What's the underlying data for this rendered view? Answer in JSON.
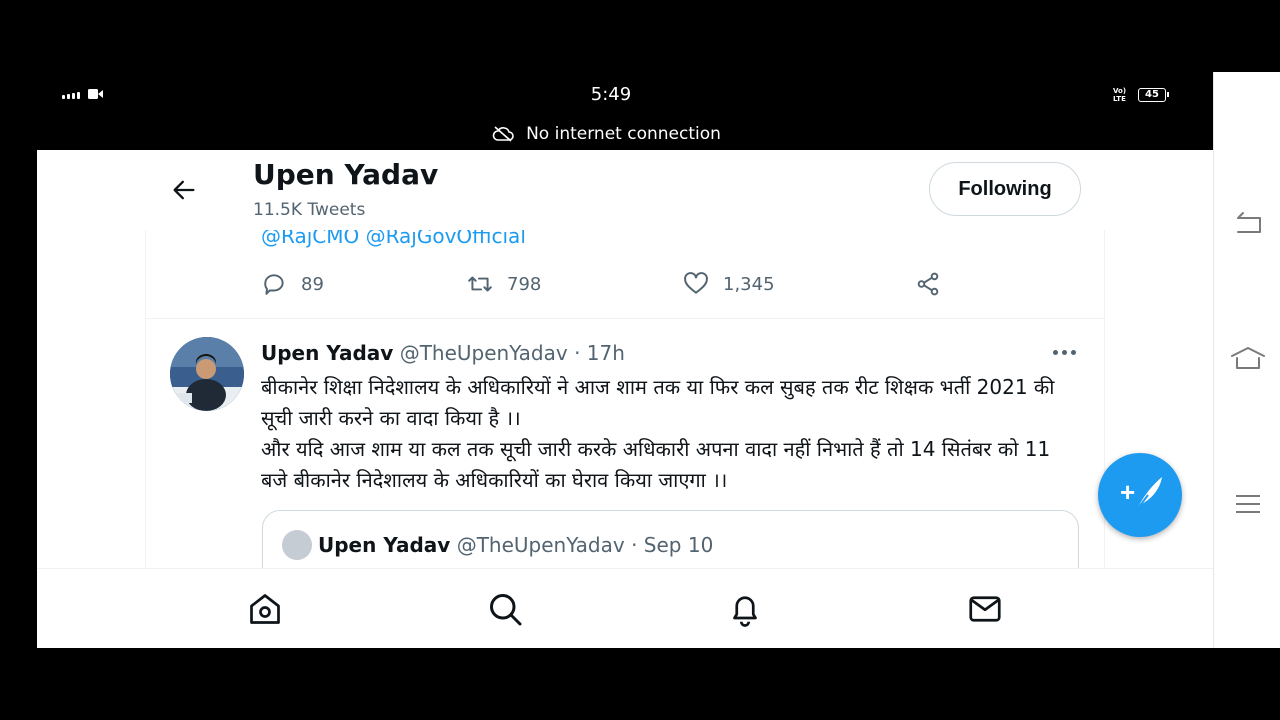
{
  "status_bar": {
    "time": "5:49",
    "network_label": "Vo) LTE",
    "battery_level": "45",
    "connection_message": "No internet connection"
  },
  "header": {
    "name": "Upen Yadav",
    "tweet_count": "11.5K Tweets",
    "follow_label": "Following"
  },
  "prev_tweet": {
    "mentions": "@RajCMO @RajGovOfficial",
    "replies": "89",
    "retweets": "798",
    "likes": "1,345"
  },
  "tweet": {
    "name": "Upen Yadav",
    "handle": "@TheUpenYadav",
    "time": " · 17h",
    "body_line1": "बीकानेर शिक्षा निदेशालय के अधिकारियों ने आज शाम तक या फिर कल सुबह तक रीट शिक्षक भर्ती 2021 की सूची जारी करने का वादा किया है ।।",
    "body_line2": "और यदि आज शाम या कल तक सूची जारी करके  अधिकारी अपना वादा नहीं निभाते हैं तो 14 सितंबर को 11 बजे बीकानेर निदेशालय के अधिकारियों का घेराव किया जाएगा ।।"
  },
  "quoted_tweet": {
    "name": "Upen Yadav",
    "handle": "@TheUpenYadav",
    "time": " · Sep 10"
  },
  "colors": {
    "accent": "#1d9bf0",
    "text_primary": "#0f1419",
    "text_secondary": "#536471",
    "border": "#cfd9de"
  },
  "icons": {
    "back": "arrow-left-icon",
    "reply": "comment-icon",
    "retweet": "retweet-icon",
    "like": "heart-icon",
    "share": "share-icon",
    "compose": "compose-tweet-icon",
    "nav": [
      "home-icon",
      "search-icon",
      "bell-icon",
      "mail-icon"
    ],
    "system": [
      "system-back-icon",
      "system-home-icon",
      "system-menu-icon"
    ]
  }
}
